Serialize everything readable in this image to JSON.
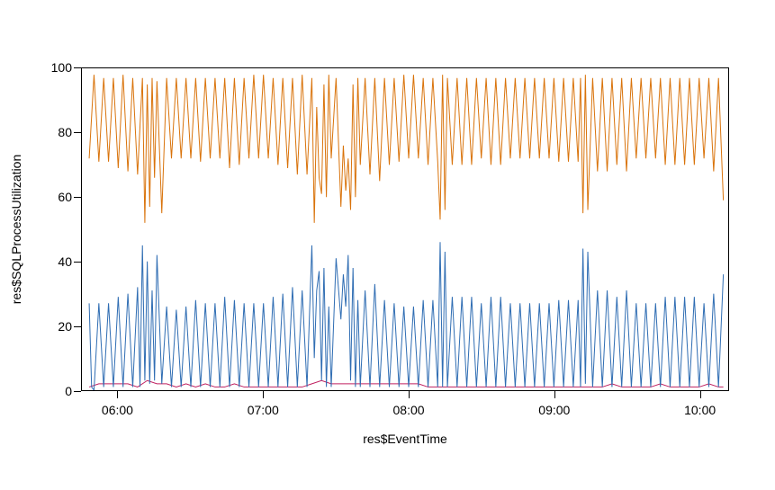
{
  "chart_data": {
    "type": "line",
    "xlabel": "res$EventTime",
    "ylabel": "res$SQLProcessUtilization",
    "ylim": [
      0,
      100
    ],
    "xlim": [
      345,
      612
    ],
    "y_ticks": [
      0,
      20,
      40,
      60,
      80,
      100
    ],
    "x_ticks": [
      {
        "value": 360,
        "label": "06:00"
      },
      {
        "value": 420,
        "label": "07:00"
      },
      {
        "value": 480,
        "label": "08:00"
      },
      {
        "value": 540,
        "label": "09:00"
      },
      {
        "value": 600,
        "label": "10:00"
      }
    ],
    "series": [
      {
        "name": "orange",
        "color": "#d9730b",
        "x": [
          348,
          350,
          352,
          354,
          356,
          358,
          360,
          362,
          364,
          366,
          368,
          370,
          371,
          372,
          373,
          374,
          375,
          376,
          378,
          380,
          382,
          384,
          386,
          388,
          390,
          392,
          394,
          396,
          398,
          400,
          402,
          404,
          406,
          408,
          410,
          412,
          414,
          416,
          418,
          420,
          422,
          424,
          426,
          428,
          430,
          432,
          434,
          436,
          438,
          440,
          441,
          442,
          443,
          444,
          445,
          446,
          447,
          448,
          450,
          452,
          453,
          454,
          455,
          456,
          457,
          458,
          459,
          460,
          462,
          464,
          466,
          468,
          470,
          472,
          474,
          476,
          478,
          480,
          482,
          484,
          486,
          488,
          490,
          492,
          493,
          494,
          495,
          496,
          498,
          500,
          502,
          504,
          506,
          508,
          510,
          512,
          514,
          516,
          518,
          520,
          522,
          524,
          526,
          528,
          530,
          532,
          534,
          536,
          538,
          540,
          542,
          544,
          546,
          548,
          550,
          551,
          552,
          553,
          554,
          556,
          558,
          560,
          562,
          564,
          566,
          568,
          570,
          572,
          574,
          576,
          578,
          580,
          582,
          584,
          586,
          588,
          590,
          592,
          594,
          596,
          598,
          600,
          602,
          604,
          606,
          608,
          610
        ],
        "values": [
          72,
          98,
          71,
          97,
          71,
          97,
          69,
          98,
          68,
          97,
          67,
          97,
          52,
          95,
          57,
          97,
          66,
          96,
          55,
          97,
          72,
          97,
          72,
          97,
          72,
          97,
          71,
          97,
          72,
          97,
          72,
          97,
          69,
          97,
          70,
          97,
          72,
          98,
          72,
          98,
          72,
          97,
          70,
          97,
          69,
          97,
          67,
          98,
          67,
          97,
          52,
          88,
          66,
          61,
          95,
          60,
          98,
          72,
          97,
          57,
          76,
          62,
          72,
          56,
          95,
          60,
          97,
          70,
          97,
          67,
          97,
          65,
          97,
          70,
          97,
          71,
          98,
          72,
          98,
          72,
          97,
          70,
          97,
          71,
          53,
          98,
          56,
          97,
          70,
          97,
          70,
          97,
          70,
          97,
          72,
          97,
          70,
          97,
          70,
          97,
          72,
          97,
          72,
          97,
          72,
          97,
          72,
          97,
          72,
          97,
          71,
          97,
          71,
          97,
          71,
          97,
          55,
          98,
          56,
          97,
          68,
          97,
          68,
          97,
          70,
          97,
          68,
          97,
          72,
          97,
          72,
          97,
          72,
          97,
          70,
          97,
          70,
          97,
          70,
          97,
          70,
          97,
          72,
          97,
          68,
          97,
          59
        ]
      },
      {
        "name": "blue",
        "color": "#2f6db3",
        "x": [
          348,
          349,
          350,
          352,
          354,
          356,
          358,
          360,
          362,
          364,
          366,
          368,
          369,
          370,
          371,
          372,
          373,
          374,
          375,
          376,
          378,
          380,
          382,
          384,
          386,
          388,
          390,
          392,
          394,
          396,
          398,
          400,
          402,
          404,
          406,
          408,
          410,
          412,
          414,
          416,
          418,
          420,
          422,
          424,
          426,
          428,
          430,
          432,
          434,
          436,
          438,
          440,
          441,
          442,
          443,
          444,
          445,
          446,
          447,
          448,
          450,
          452,
          453,
          454,
          455,
          456,
          457,
          458,
          459,
          460,
          462,
          464,
          466,
          468,
          470,
          472,
          474,
          476,
          478,
          480,
          482,
          484,
          486,
          488,
          490,
          492,
          493,
          494,
          495,
          496,
          498,
          500,
          502,
          504,
          506,
          508,
          510,
          512,
          514,
          516,
          518,
          520,
          522,
          524,
          526,
          528,
          530,
          532,
          534,
          536,
          538,
          540,
          542,
          544,
          546,
          548,
          550,
          551,
          552,
          553,
          554,
          556,
          558,
          560,
          562,
          564,
          566,
          568,
          570,
          572,
          574,
          576,
          578,
          580,
          582,
          584,
          586,
          588,
          590,
          592,
          594,
          596,
          598,
          600,
          602,
          604,
          606,
          608,
          610
        ],
        "values": [
          27,
          1,
          0,
          27,
          1,
          27,
          1,
          29,
          1,
          30,
          1,
          32,
          1,
          45,
          3,
          40,
          2,
          31,
          3,
          42,
          2,
          26,
          1,
          25,
          1,
          26,
          1,
          28,
          1,
          27,
          1,
          27,
          1,
          29,
          1,
          28,
          1,
          27,
          1,
          27,
          1,
          27,
          1,
          29,
          1,
          30,
          1,
          32,
          1,
          31,
          1,
          45,
          10,
          31,
          37,
          3,
          38,
          1,
          26,
          1,
          41,
          22,
          36,
          26,
          42,
          3,
          38,
          1,
          28,
          1,
          31,
          1,
          33,
          1,
          28,
          1,
          27,
          1,
          26,
          1,
          26,
          1,
          28,
          1,
          28,
          1,
          46,
          1,
          43,
          1,
          29,
          1,
          29,
          1,
          29,
          1,
          27,
          1,
          29,
          1,
          29,
          1,
          27,
          1,
          27,
          1,
          27,
          1,
          27,
          1,
          27,
          1,
          28,
          1,
          28,
          1,
          28,
          1,
          44,
          2,
          43,
          1,
          31,
          1,
          31,
          1,
          29,
          1,
          31,
          1,
          27,
          1,
          27,
          1,
          27,
          1,
          29,
          1,
          29,
          1,
          29,
          1,
          29,
          1,
          27,
          1,
          30,
          1,
          36
        ]
      },
      {
        "name": "red",
        "color": "#c02060",
        "x": [
          348,
          352,
          356,
          360,
          364,
          368,
          372,
          376,
          380,
          384,
          388,
          392,
          396,
          400,
          404,
          408,
          412,
          416,
          420,
          424,
          428,
          432,
          436,
          440,
          444,
          448,
          452,
          456,
          460,
          464,
          468,
          472,
          476,
          480,
          484,
          488,
          492,
          496,
          500,
          504,
          508,
          512,
          516,
          520,
          524,
          528,
          532,
          536,
          540,
          544,
          548,
          552,
          556,
          560,
          564,
          568,
          572,
          576,
          580,
          584,
          588,
          592,
          596,
          600,
          604,
          608,
          610
        ],
        "values": [
          1,
          2,
          2,
          2,
          2,
          1,
          3,
          2,
          2,
          1,
          2,
          1,
          2,
          1,
          1,
          2,
          1,
          1,
          1,
          1,
          1,
          1,
          1,
          2,
          3,
          2,
          2,
          2,
          2,
          2,
          2,
          2,
          2,
          2,
          2,
          1,
          1,
          1,
          1,
          1,
          1,
          1,
          1,
          1,
          1,
          1,
          1,
          1,
          1,
          1,
          1,
          1,
          1,
          1,
          2,
          1,
          1,
          1,
          1,
          2,
          1,
          1,
          1,
          1,
          2,
          1,
          1
        ]
      }
    ]
  }
}
